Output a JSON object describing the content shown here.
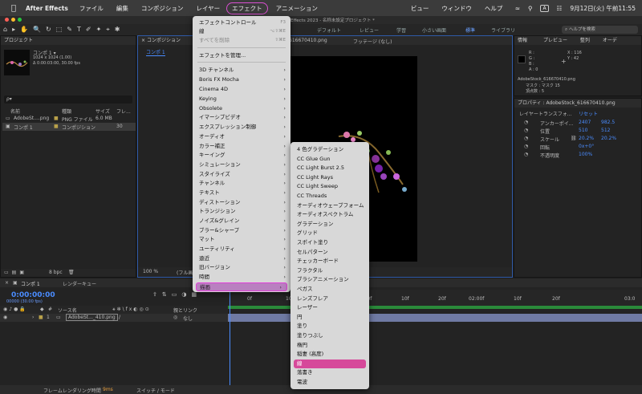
{
  "menubar": {
    "app": "After Effects",
    "items": [
      "ファイル",
      "編集",
      "コンポジション",
      "レイヤー",
      "エフェクト",
      "アニメーション",
      "ビュー",
      "ウィンドウ",
      "ヘルプ"
    ],
    "datetime": "9月12日(火) 午前11:55",
    "input_indicator": "A"
  },
  "window": {
    "title": "Effects 2023 - 名称未設定プロジェクト *"
  },
  "toolbar": {
    "workspaces": [
      "デフォルト",
      "レビュー",
      "学習",
      "小さい画面",
      "標準",
      "ライブラリ"
    ],
    "active_workspace": "標準",
    "search_placeholder": "ヘルプを検索"
  },
  "project": {
    "title": "プロジェクト",
    "comp_name": "コンポ 1 ▾",
    "comp_info1": "1024 x 1024 (1.00)",
    "comp_info2": "Δ 0:00:03:00, 30.00 fps",
    "search_placeholder": "ρ▾",
    "columns": [
      "名前",
      "種類",
      "サイズ",
      "フレ..."
    ],
    "rows": [
      {
        "name": "AdobeSt....png",
        "type": "PNG ファイル",
        "size": "6.0 MB",
        "fr": ""
      },
      {
        "name": "コンポ 1",
        "type": "コンポジション",
        "size": "",
        "fr": "30"
      }
    ],
    "bpc": "8 bpc"
  },
  "viewer": {
    "tab": "コンポジション",
    "subtab": "コンポ 1",
    "footage_label": "フッテージ (なし)",
    "layer_file": "616670410.png",
    "zoom": "100 %",
    "quality": "(フル画"
  },
  "info": {
    "tabs": [
      "情報",
      "プレビュー",
      "整列",
      "オーデ"
    ],
    "r": "R :",
    "g": "G :",
    "b": "B :",
    "a": "A : 0",
    "x": "X : 116",
    "y": "Y : 42",
    "file": "AdobeStock_616670410.png",
    "mask": "マスク : マスク 15",
    "vertex": "頂点数 : 5"
  },
  "properties": {
    "title": "プロパティ : AdobeStock_616670410.png",
    "section": "レイヤートランスフォ...",
    "reset": "リセット",
    "items": [
      {
        "label": "アンカーポイ...",
        "v1": "2407",
        "v2": "982.5"
      },
      {
        "label": "位置",
        "v1": "510",
        "v2": "512"
      },
      {
        "label": "スケール",
        "v1": "20.2%",
        "v2": "20.2%"
      },
      {
        "label": "回転",
        "v1": "0x+0°",
        "v2": ""
      },
      {
        "label": "不透明度",
        "v1": "100%",
        "v2": ""
      }
    ]
  },
  "effect_menu": {
    "items": [
      {
        "label": "エフェクトコントロール",
        "shortcut": "F3",
        "disabled": false
      },
      {
        "label": "線",
        "shortcut": "⌥⇧⌘E",
        "disabled": false
      },
      {
        "label": "すべてを削除",
        "shortcut": "⇧⌘E",
        "disabled": true
      },
      {
        "label": "エフェクトを管理...",
        "shortcut": "",
        "disabled": false
      },
      {
        "label": "3D チャンネル",
        "arrow": true
      },
      {
        "label": "Boris FX Mocha",
        "arrow": true
      },
      {
        "label": "Cinema 4D",
        "arrow": true
      },
      {
        "label": "Keying",
        "arrow": true
      },
      {
        "label": "Obsolete",
        "arrow": true
      },
      {
        "label": "イマーシブビデオ",
        "arrow": true
      },
      {
        "label": "エクスプレッション制御",
        "arrow": true
      },
      {
        "label": "オーディオ",
        "arrow": true
      },
      {
        "label": "カラー補正",
        "arrow": true
      },
      {
        "label": "キーイング",
        "arrow": true
      },
      {
        "label": "シミュレーション",
        "arrow": true
      },
      {
        "label": "スタイライズ",
        "arrow": true
      },
      {
        "label": "チャンネル",
        "arrow": true
      },
      {
        "label": "テキスト",
        "arrow": true
      },
      {
        "label": "ディストーション",
        "arrow": true
      },
      {
        "label": "トランジション",
        "arrow": true
      },
      {
        "label": "ノイズ&グレイン",
        "arrow": true
      },
      {
        "label": "ブラー&シャープ",
        "arrow": true
      },
      {
        "label": "マット",
        "arrow": true
      },
      {
        "label": "ユーティリティ",
        "arrow": true
      },
      {
        "label": "遠近",
        "arrow": true
      },
      {
        "label": "旧バージョン",
        "arrow": true
      },
      {
        "label": "時間",
        "arrow": true
      },
      {
        "label": "描画",
        "arrow": true
      }
    ]
  },
  "render_submenu": {
    "items": [
      "4 色グラデーション",
      "CC Glue Gun",
      "CC Light Burst 2.5",
      "CC Light Rays",
      "CC Light Sweep",
      "CC Threads",
      "オーディオウェーブフォーム",
      "オーディオスペクトラム",
      "グラデーション",
      "グリッド",
      "スポイト塗り",
      "セルパターン",
      "チェッカーボード",
      "フラクタル",
      "ブラシアニメーション",
      "ペガス",
      "レンズフレア",
      "レーザー",
      "円",
      "塗り",
      "塗りつぶし",
      "楕円",
      "稲妻 (高度)",
      "線",
      "落書き",
      "電波"
    ],
    "highlighted": "線"
  },
  "timeline": {
    "tab": "コンポ 1",
    "render_queue": "レンダーキュー",
    "timecode": "0:00:00:00",
    "timecode_sub": "00000 (30.00 fps)",
    "columns": [
      "ソース名",
      "親とリンク"
    ],
    "layer_num": "1",
    "layer_name": "AdobeSt..._410.png",
    "parent": "なし",
    "ruler": [
      "0f",
      "10f",
      "20f",
      "01:00f",
      "10f",
      "20f",
      "02:00f",
      "10f",
      "20f",
      "03:0"
    ]
  },
  "statusbar": {
    "render_time_label": "フレームレンダリング時間",
    "render_time": "9ms",
    "switch_mode": "スイッチ / モード"
  }
}
